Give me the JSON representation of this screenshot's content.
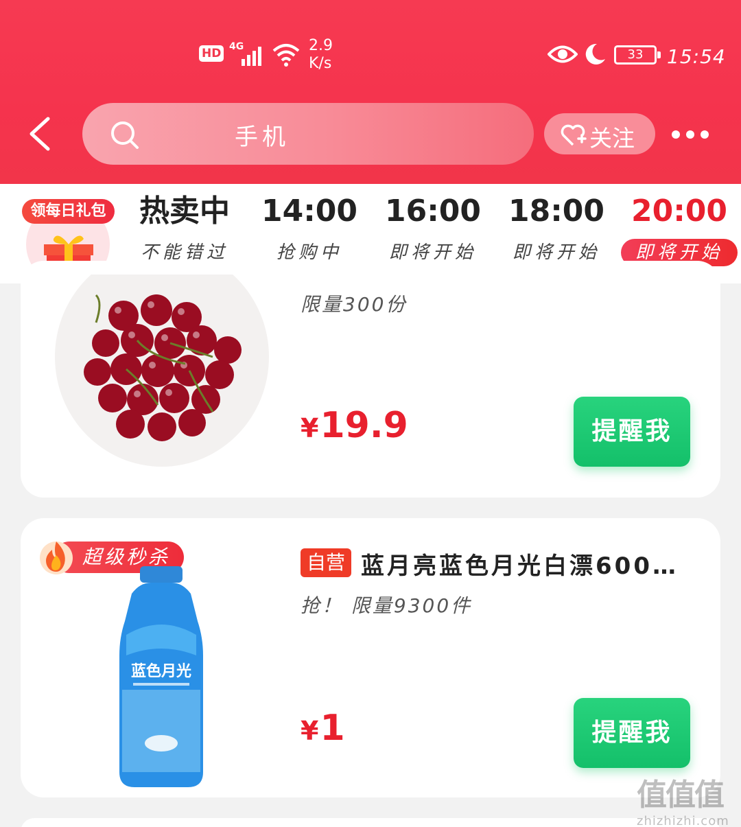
{
  "status_bar": {
    "hd": "HD",
    "network": "4G",
    "speed": "2.9\nK/s",
    "battery": "33",
    "time": "15:54"
  },
  "header": {
    "search_value": "手机",
    "follow_label": "关注",
    "icons": [
      "back-arrow-icon",
      "search-icon",
      "heart-plus-icon",
      "more-dots-icon"
    ]
  },
  "tabs": {
    "gift_label": "领每日礼包",
    "items": [
      {
        "time": "热卖中",
        "status": "不能错过"
      },
      {
        "time": "14:00",
        "status": "抢购中"
      },
      {
        "time": "16:00",
        "status": "即将开始"
      },
      {
        "time": "18:00",
        "status": "即将开始"
      },
      {
        "time": "20:00",
        "status": "即将开始"
      }
    ],
    "active_index": 4
  },
  "products": [
    {
      "limit": "限量300份",
      "currency": "¥",
      "price": "19.9",
      "button": "提醒我"
    },
    {
      "badge": "超级秒杀",
      "tag": "自营",
      "title": "蓝月亮蓝色月光白漂600…",
      "limit": "抢！ 限量9300件",
      "currency": "¥",
      "price": "1",
      "button": "提醒我",
      "image_text": "蓝色月光"
    }
  ],
  "colors": {
    "brand_red": "#f5334d",
    "active_red": "#e8202e",
    "button_green": "#1bc872"
  },
  "watermark": {
    "main": "值值值",
    "url": "zhizhizhi.com"
  }
}
